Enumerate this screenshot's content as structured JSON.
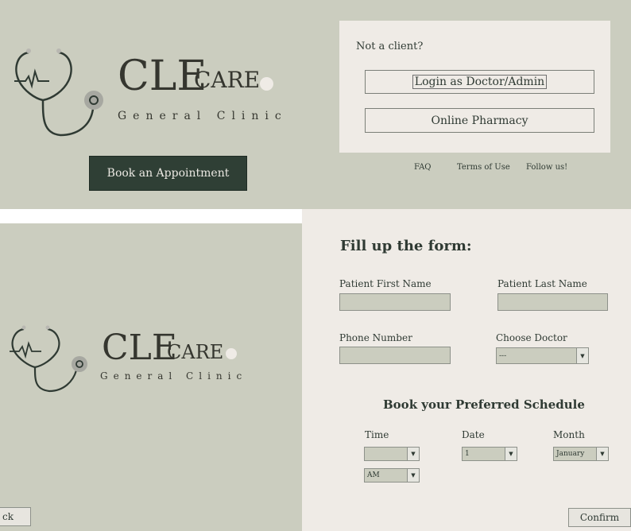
{
  "header": {
    "logo": {
      "cle": "CLE",
      "care": "CARE",
      "subtitle": "General Clinic"
    },
    "book_button": "Book an Appointment"
  },
  "login_card": {
    "not_client": "Not a client?",
    "login_button": "Login as Doctor/Admin",
    "pharmacy_button": "Online Pharmacy"
  },
  "footer_links": [
    "FAQ",
    "Terms of Use",
    "Follow us!"
  ],
  "form": {
    "title": "Fill up the form:",
    "first_name_label": "Patient First Name",
    "last_name_label": "Patient Last Name",
    "phone_label": "Phone Number",
    "doctor_label": "Choose Doctor",
    "doctor_value": "---",
    "schedule_title": "Book your Preferred Schedule",
    "time_label": "Time",
    "date_label": "Date",
    "month_label": "Month",
    "time_value": "",
    "ampm_value": "AM",
    "date_value": "1",
    "month_value": "January",
    "confirm": "Confirm",
    "back": "ck"
  },
  "colors": {
    "sage": "#cbcdbf",
    "cream": "#efebe6",
    "dark_green": "#2f3f35"
  }
}
